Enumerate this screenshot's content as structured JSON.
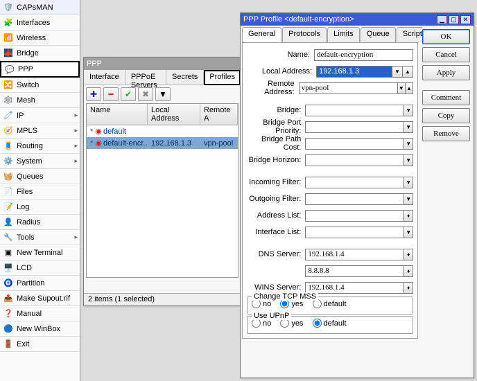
{
  "sidebar": [
    {
      "label": "CAPsMAN",
      "icon": "🛡️",
      "sub": false
    },
    {
      "label": "Interfaces",
      "icon": "🧩",
      "sub": false
    },
    {
      "label": "Wireless",
      "icon": "📶",
      "sub": false
    },
    {
      "label": "Bridge",
      "icon": "🌉",
      "sub": false
    },
    {
      "label": "PPP",
      "icon": "💬",
      "sub": false,
      "sel": true
    },
    {
      "label": "Switch",
      "icon": "🔀",
      "sub": false
    },
    {
      "label": "Mesh",
      "icon": "🕸️",
      "sub": false
    },
    {
      "label": "IP",
      "icon": "🧷",
      "sub": true
    },
    {
      "label": "MPLS",
      "icon": "🧭",
      "sub": true
    },
    {
      "label": "Routing",
      "icon": "🧵",
      "sub": true
    },
    {
      "label": "System",
      "icon": "⚙️",
      "sub": true
    },
    {
      "label": "Queues",
      "icon": "🧺",
      "sub": false
    },
    {
      "label": "Files",
      "icon": "📄",
      "sub": false
    },
    {
      "label": "Log",
      "icon": "📝",
      "sub": false
    },
    {
      "label": "Radius",
      "icon": "👤",
      "sub": false
    },
    {
      "label": "Tools",
      "icon": "🔧",
      "sub": true
    },
    {
      "label": "New Terminal",
      "icon": "▣",
      "sub": false
    },
    {
      "label": "LCD",
      "icon": "🖥️",
      "sub": false
    },
    {
      "label": "Partition",
      "icon": "🧿",
      "sub": false
    },
    {
      "label": "Make Supout.rif",
      "icon": "📤",
      "sub": false
    },
    {
      "label": "Manual",
      "icon": "❓",
      "sub": false
    },
    {
      "label": "New WinBox",
      "icon": "🔵",
      "sub": false
    },
    {
      "label": "Exit",
      "icon": "🚪",
      "sub": false
    }
  ],
  "ppp": {
    "title": "PPP",
    "tabs": [
      "Interface",
      "PPPoE Servers",
      "Secrets",
      "Profiles"
    ],
    "active_tab": 3,
    "cols": [
      "Name",
      "Local Address",
      "Remote A"
    ],
    "rows": [
      {
        "name": "default",
        "local": "",
        "remote": "",
        "sel": false,
        "marker": "*"
      },
      {
        "name": "default-encr...",
        "local": "192.168.1.3",
        "remote": "vpn-pool",
        "sel": true,
        "marker": "*"
      }
    ],
    "status": "2 items (1 selected)"
  },
  "dialog": {
    "title": "PPP Profile <default-encryption>",
    "tabs": [
      "General",
      "Protocols",
      "Limits",
      "Queue",
      "Scripts"
    ],
    "active_tab": 0,
    "buttons": [
      "OK",
      "Cancel",
      "Apply",
      "Comment",
      "Copy",
      "Remove"
    ],
    "fields": {
      "name_label": "Name:",
      "name": "default-encryption",
      "local_label": "Local Address:",
      "local": "192.168.1.3",
      "remote_label": "Remote Address:",
      "remote": "vpn-pool",
      "bridge_label": "Bridge:",
      "bpp_label": "Bridge Port Priority:",
      "bpc_label": "Bridge Path Cost:",
      "bh_label": "Bridge Horizon:",
      "infilter_label": "Incoming Filter:",
      "outfilter_label": "Outgoing Filter:",
      "addrlist_label": "Address List:",
      "iflist_label": "Interface List:",
      "dns_label": "DNS Server:",
      "dns1": "192.168.1.4",
      "dns2": "8.8.8.8",
      "wins_label": "WINS Server:",
      "wins": "192.168.1.4",
      "mss_legend": "Change TCP MSS",
      "upnp_legend": "Use UPnP",
      "r_no": "no",
      "r_yes": "yes",
      "r_def": "default"
    }
  }
}
